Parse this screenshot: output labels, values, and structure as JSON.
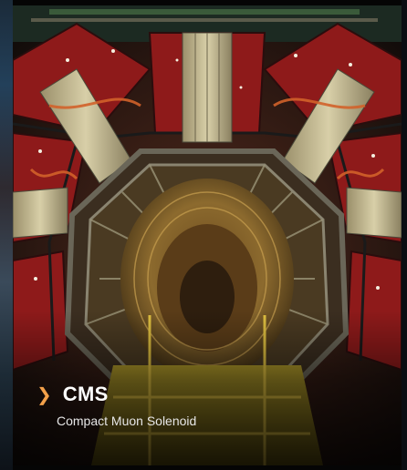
{
  "card": {
    "title": "CMS",
    "subtitle": "Compact Muon Solenoid"
  },
  "icons": {
    "chevron": "chevron-right-icon"
  },
  "colors": {
    "accent": "#f2a04a",
    "title": "#ffffff",
    "subtitle": "#e6e6e6"
  }
}
